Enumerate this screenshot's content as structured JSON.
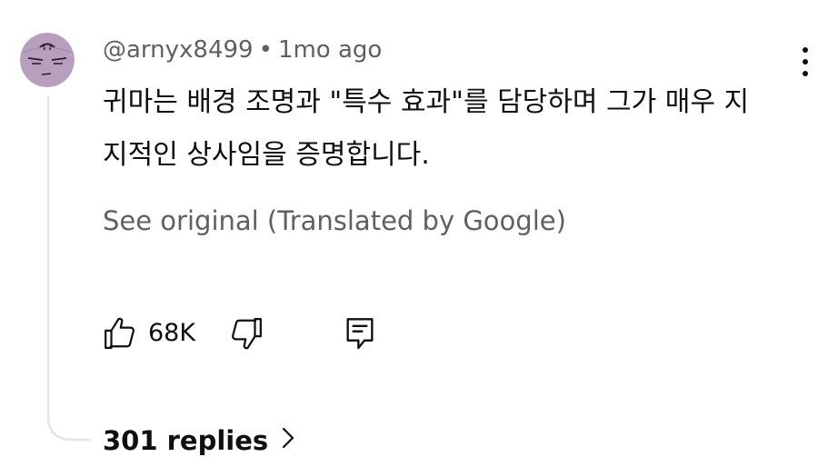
{
  "comment": {
    "author": "@arnyx8499",
    "separator": "•",
    "time": "1mo ago",
    "text_line1": "귀마는 배경 조명과 \"특수 효과\"를 담당하며 그가 매우 지",
    "text_line2": "지적인 상사임을 증명합니다.",
    "translation_link": "See original (Translated by Google)",
    "like_count": "68K",
    "replies_label": "301 replies"
  },
  "icons": {
    "avatar": "avatar",
    "more": "more-vert-icon",
    "like": "thumb-up-icon",
    "dislike": "thumb-down-icon",
    "reply": "reply-comment-icon",
    "chevron": "chevron-right-icon"
  },
  "colors": {
    "text_primary": "#0f0f0f",
    "text_secondary": "#606060",
    "avatar_bg": "#b89fbe",
    "thread_line": "#e5e5e5"
  }
}
